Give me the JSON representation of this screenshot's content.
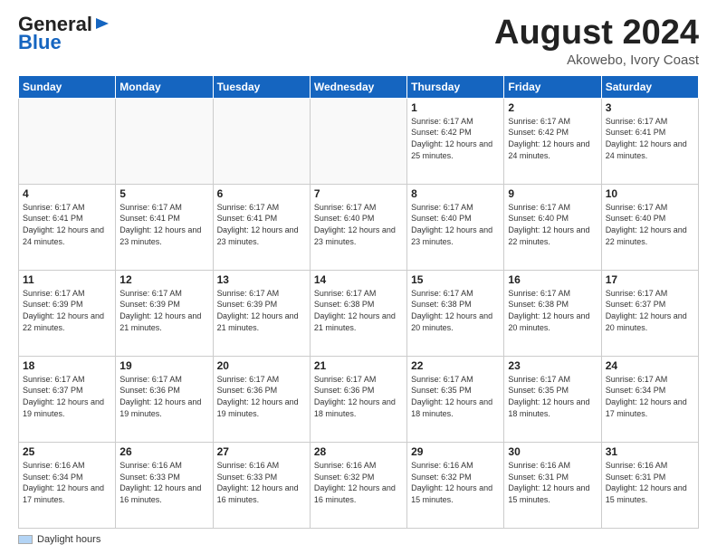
{
  "logo": {
    "general": "General",
    "blue": "Blue"
  },
  "header": {
    "month_year": "August 2024",
    "location": "Akowebo, Ivory Coast"
  },
  "days_of_week": [
    "Sunday",
    "Monday",
    "Tuesday",
    "Wednesday",
    "Thursday",
    "Friday",
    "Saturday"
  ],
  "legend": {
    "label": "Daylight hours"
  },
  "weeks": [
    [
      {
        "day": "",
        "info": ""
      },
      {
        "day": "",
        "info": ""
      },
      {
        "day": "",
        "info": ""
      },
      {
        "day": "",
        "info": ""
      },
      {
        "day": "1",
        "info": "Sunrise: 6:17 AM\nSunset: 6:42 PM\nDaylight: 12 hours and 25 minutes."
      },
      {
        "day": "2",
        "info": "Sunrise: 6:17 AM\nSunset: 6:42 PM\nDaylight: 12 hours and 24 minutes."
      },
      {
        "day": "3",
        "info": "Sunrise: 6:17 AM\nSunset: 6:41 PM\nDaylight: 12 hours and 24 minutes."
      }
    ],
    [
      {
        "day": "4",
        "info": "Sunrise: 6:17 AM\nSunset: 6:41 PM\nDaylight: 12 hours and 24 minutes."
      },
      {
        "day": "5",
        "info": "Sunrise: 6:17 AM\nSunset: 6:41 PM\nDaylight: 12 hours and 23 minutes."
      },
      {
        "day": "6",
        "info": "Sunrise: 6:17 AM\nSunset: 6:41 PM\nDaylight: 12 hours and 23 minutes."
      },
      {
        "day": "7",
        "info": "Sunrise: 6:17 AM\nSunset: 6:40 PM\nDaylight: 12 hours and 23 minutes."
      },
      {
        "day": "8",
        "info": "Sunrise: 6:17 AM\nSunset: 6:40 PM\nDaylight: 12 hours and 23 minutes."
      },
      {
        "day": "9",
        "info": "Sunrise: 6:17 AM\nSunset: 6:40 PM\nDaylight: 12 hours and 22 minutes."
      },
      {
        "day": "10",
        "info": "Sunrise: 6:17 AM\nSunset: 6:40 PM\nDaylight: 12 hours and 22 minutes."
      }
    ],
    [
      {
        "day": "11",
        "info": "Sunrise: 6:17 AM\nSunset: 6:39 PM\nDaylight: 12 hours and 22 minutes."
      },
      {
        "day": "12",
        "info": "Sunrise: 6:17 AM\nSunset: 6:39 PM\nDaylight: 12 hours and 21 minutes."
      },
      {
        "day": "13",
        "info": "Sunrise: 6:17 AM\nSunset: 6:39 PM\nDaylight: 12 hours and 21 minutes."
      },
      {
        "day": "14",
        "info": "Sunrise: 6:17 AM\nSunset: 6:38 PM\nDaylight: 12 hours and 21 minutes."
      },
      {
        "day": "15",
        "info": "Sunrise: 6:17 AM\nSunset: 6:38 PM\nDaylight: 12 hours and 20 minutes."
      },
      {
        "day": "16",
        "info": "Sunrise: 6:17 AM\nSunset: 6:38 PM\nDaylight: 12 hours and 20 minutes."
      },
      {
        "day": "17",
        "info": "Sunrise: 6:17 AM\nSunset: 6:37 PM\nDaylight: 12 hours and 20 minutes."
      }
    ],
    [
      {
        "day": "18",
        "info": "Sunrise: 6:17 AM\nSunset: 6:37 PM\nDaylight: 12 hours and 19 minutes."
      },
      {
        "day": "19",
        "info": "Sunrise: 6:17 AM\nSunset: 6:36 PM\nDaylight: 12 hours and 19 minutes."
      },
      {
        "day": "20",
        "info": "Sunrise: 6:17 AM\nSunset: 6:36 PM\nDaylight: 12 hours and 19 minutes."
      },
      {
        "day": "21",
        "info": "Sunrise: 6:17 AM\nSunset: 6:36 PM\nDaylight: 12 hours and 18 minutes."
      },
      {
        "day": "22",
        "info": "Sunrise: 6:17 AM\nSunset: 6:35 PM\nDaylight: 12 hours and 18 minutes."
      },
      {
        "day": "23",
        "info": "Sunrise: 6:17 AM\nSunset: 6:35 PM\nDaylight: 12 hours and 18 minutes."
      },
      {
        "day": "24",
        "info": "Sunrise: 6:17 AM\nSunset: 6:34 PM\nDaylight: 12 hours and 17 minutes."
      }
    ],
    [
      {
        "day": "25",
        "info": "Sunrise: 6:16 AM\nSunset: 6:34 PM\nDaylight: 12 hours and 17 minutes."
      },
      {
        "day": "26",
        "info": "Sunrise: 6:16 AM\nSunset: 6:33 PM\nDaylight: 12 hours and 16 minutes."
      },
      {
        "day": "27",
        "info": "Sunrise: 6:16 AM\nSunset: 6:33 PM\nDaylight: 12 hours and 16 minutes."
      },
      {
        "day": "28",
        "info": "Sunrise: 6:16 AM\nSunset: 6:32 PM\nDaylight: 12 hours and 16 minutes."
      },
      {
        "day": "29",
        "info": "Sunrise: 6:16 AM\nSunset: 6:32 PM\nDaylight: 12 hours and 15 minutes."
      },
      {
        "day": "30",
        "info": "Sunrise: 6:16 AM\nSunset: 6:31 PM\nDaylight: 12 hours and 15 minutes."
      },
      {
        "day": "31",
        "info": "Sunrise: 6:16 AM\nSunset: 6:31 PM\nDaylight: 12 hours and 15 minutes."
      }
    ]
  ]
}
